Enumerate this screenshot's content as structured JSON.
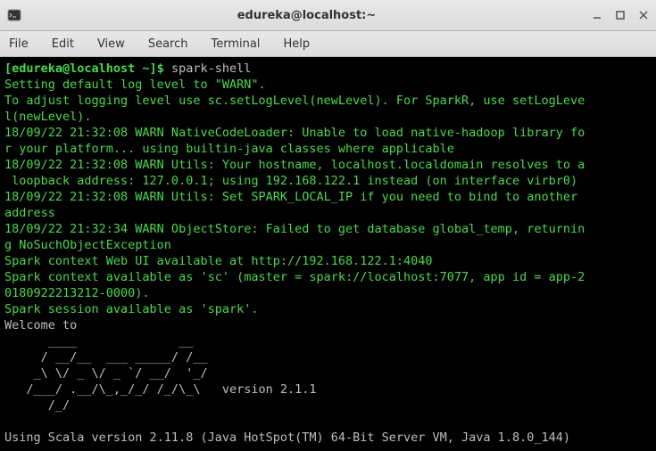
{
  "window": {
    "title": "edureka@localhost:~"
  },
  "menubar": {
    "file": "File",
    "edit": "Edit",
    "view": "View",
    "search": "Search",
    "terminal": "Terminal",
    "help": "Help"
  },
  "terminal": {
    "prompt": "[edureka@localhost ~]$ ",
    "command": "spark-shell",
    "lines": {
      "l1": "Setting default log level to \"WARN\".",
      "l2": "To adjust logging level use sc.setLogLevel(newLevel). For SparkR, use setLogLeve",
      "l3": "l(newLevel).",
      "l4": "18/09/22 21:32:08 WARN NativeCodeLoader: Unable to load native-hadoop library fo",
      "l5": "r your platform... using builtin-java classes where applicable",
      "l6": "18/09/22 21:32:08 WARN Utils: Your hostname, localhost.localdomain resolves to a",
      "l7": " loopback address: 127.0.0.1; using 192.168.122.1 instead (on interface virbr0)",
      "l8": "18/09/22 21:32:08 WARN Utils: Set SPARK_LOCAL_IP if you need to bind to another ",
      "l9": "address",
      "l10": "18/09/22 21:32:34 WARN ObjectStore: Failed to get database global_temp, returnin",
      "l11": "g NoSuchObjectException",
      "l12": "Spark context Web UI available at http://192.168.122.1:4040",
      "l13": "Spark context available as 'sc' (master = spark://localhost:7077, app id = app-2",
      "l14": "0180922213212-0000).",
      "l15": "Spark session available as 'spark'.",
      "l16": "Welcome to",
      "ascii1": "      ____              __",
      "ascii2": "     / __/__  ___ _____/ /__",
      "ascii3": "    _\\ \\/ _ \\/ _ `/ __/  '_/",
      "ascii4": "   /___/ .__/\\_,_/_/ /_/\\_\\   version 2.1.1",
      "ascii5": "      /_/",
      "blank": "",
      "scala": "Using Scala version 2.11.8 (Java HotSpot(TM) 64-Bit Server VM, Java 1.8.0_144)"
    }
  }
}
